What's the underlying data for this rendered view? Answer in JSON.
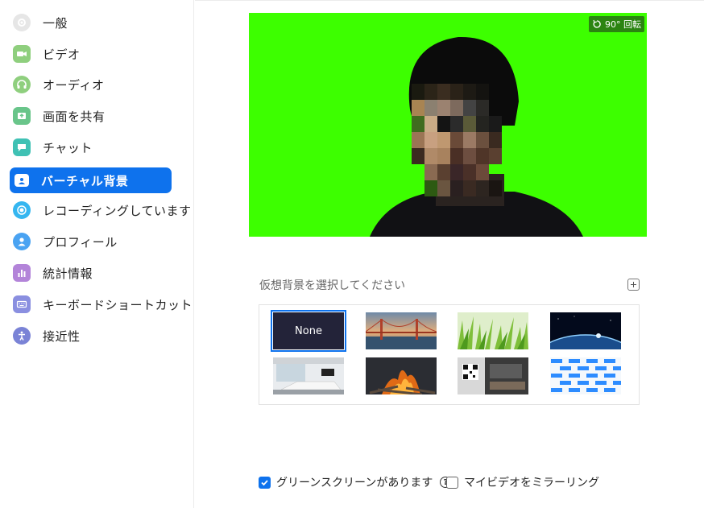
{
  "sidebar": {
    "items": [
      {
        "label": "一般",
        "icon": "gear-icon",
        "color": "#e3e3e3"
      },
      {
        "label": "ビデオ",
        "icon": "video-camera-icon",
        "color": "#8fcf7e"
      },
      {
        "label": "オーディオ",
        "icon": "headphones-icon",
        "color": "#8fcf7e"
      },
      {
        "label": "画面を共有",
        "icon": "share-screen-icon",
        "color": "#69c58a"
      },
      {
        "label": "チャット",
        "icon": "chat-bubble-icon",
        "color": "#3fc1b4"
      },
      {
        "label": "バーチャル背景",
        "icon": "person-card-icon",
        "color": "#0e72ed"
      },
      {
        "label": "レコーディングしています",
        "icon": "record-icon",
        "color": "#35b6f0"
      },
      {
        "label": "プロフィール",
        "icon": "user-icon",
        "color": "#4aa3f2"
      },
      {
        "label": "統計情報",
        "icon": "bar-chart-icon",
        "color": "#b384d9"
      },
      {
        "label": "キーボードショートカット",
        "icon": "keyboard-icon",
        "color": "#8a8fe0"
      },
      {
        "label": "接近性",
        "icon": "accessibility-icon",
        "color": "#7a83d6"
      }
    ],
    "active_index": 5
  },
  "preview": {
    "rotate_label": "90° 回転",
    "background_color": "#3dff00"
  },
  "background_section": {
    "title": "仮想背景を選択してください",
    "thumbnails": [
      {
        "label": "None",
        "kind": "none",
        "selected": true
      },
      {
        "kind": "golden-gate-bridge"
      },
      {
        "kind": "grass"
      },
      {
        "kind": "earth-from-space"
      },
      {
        "kind": "meeting-room"
      },
      {
        "kind": "campfire"
      },
      {
        "kind": "office-qr-code"
      },
      {
        "kind": "logo-pattern"
      }
    ]
  },
  "options": {
    "green_screen": {
      "label": "グリーンスクリーンがあります",
      "checked": true,
      "help": "?"
    },
    "mirror": {
      "label": "マイビデオをミラーリング",
      "checked": false
    }
  }
}
